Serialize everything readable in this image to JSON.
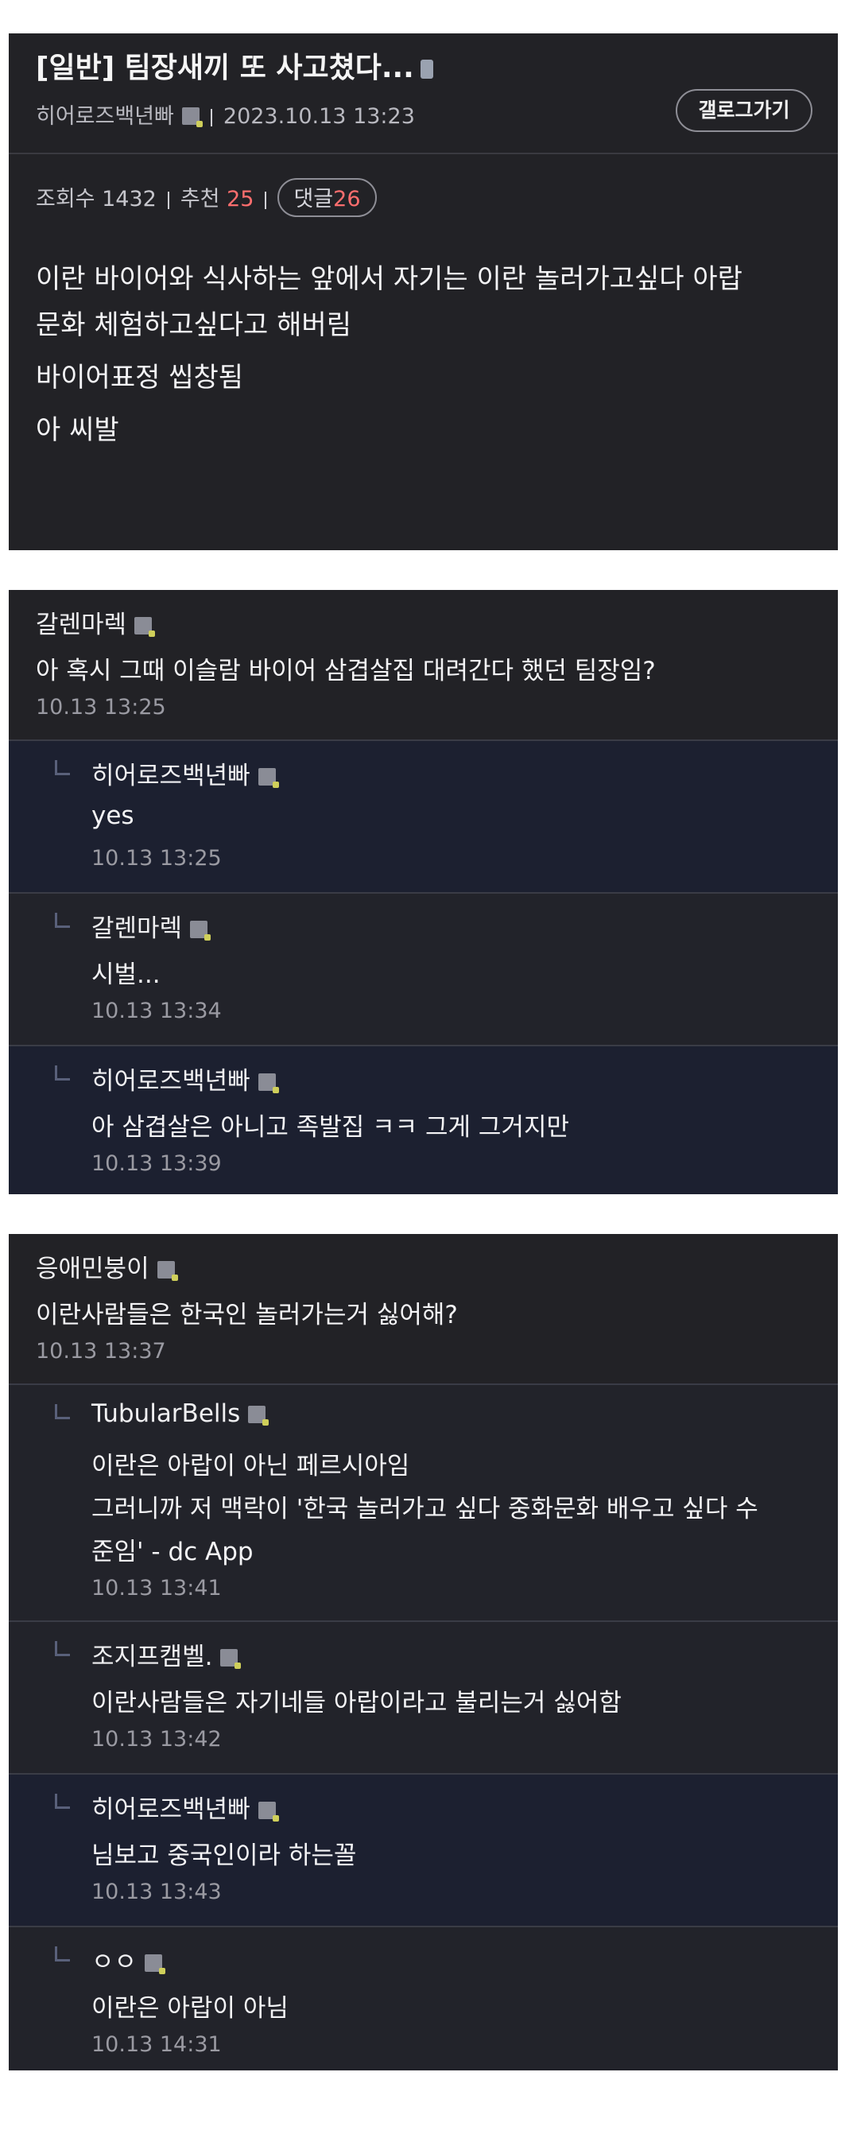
{
  "post": {
    "title": "[일반] 팀장새끼 또 사고쳤다...",
    "author": "히어로즈백년빠",
    "date": "2023.10.13 13:23",
    "gallog_label": "갤로그가기",
    "views_label": "조회수 1432",
    "recommend_label": "추천",
    "recommend_count": "25",
    "comment_label": "댓글",
    "comment_count": "26",
    "body": [
      "이란 바이어와 식사하는 앞에서 자기는 이란 놀러가고싶다 아랍",
      "문화 체험하고싶다고 해버림",
      "바이어표정 씹창됨",
      "아 씨발"
    ]
  },
  "threads": [
    {
      "comment": {
        "nick": "갈렌마렉",
        "text": "아 혹시 그때 이슬람 바이어 삼겹살집 대려간다 했던 팀장임?",
        "time": "10.13 13:25"
      },
      "replies": [
        {
          "nick": "히어로즈백년빠",
          "lines": [
            "yes"
          ],
          "time": "10.13 13:25"
        },
        {
          "nick": "갈렌마렉",
          "lines": [
            "시벌..."
          ],
          "time": "10.13 13:34"
        },
        {
          "nick": "히어로즈백년빠",
          "lines": [
            "아 삼겹살은 아니고 족발집 ㅋㅋ 그게 그거지만"
          ],
          "time": "10.13 13:39"
        }
      ]
    },
    {
      "comment": {
        "nick": "응애민붕이",
        "text": "이란사람들은 한국인 놀러가는거 싫어해?",
        "time": "10.13 13:37"
      },
      "replies": [
        {
          "nick": "TubularBells",
          "lines": [
            "이란은 아랍이 아닌 페르시아임",
            "그러니까 저 맥락이 '한국 놀러가고 싶다 중화문화 배우고 싶다 수",
            "준임' - dc App"
          ],
          "time": "10.13 13:41"
        },
        {
          "nick": "조지프캠벨.",
          "lines": [
            "이란사람들은 자기네들 아랍이라고 불리는거 싫어함"
          ],
          "time": "10.13 13:42"
        },
        {
          "nick": "히어로즈백년빠",
          "lines": [
            "님보고 중국인이라 하는꼴"
          ],
          "time": "10.13 13:43"
        },
        {
          "nick": "ㅇㅇ",
          "lines": [
            "이란은 아랍이 아님"
          ],
          "time": "10.13 14:31"
        }
      ]
    }
  ]
}
